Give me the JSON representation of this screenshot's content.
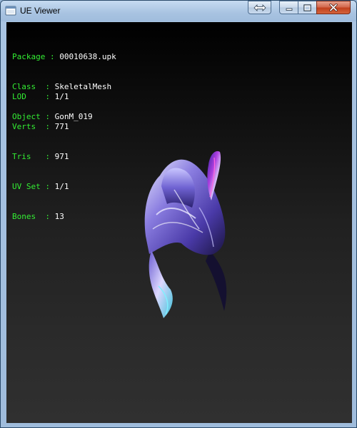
{
  "window": {
    "title": "UE Viewer"
  },
  "info_block_1": [
    {
      "label": "Package",
      "sep": " : ",
      "pad": "",
      "value": "00010638.upk"
    },
    {
      "label": "Class",
      "sep": "  : ",
      "pad": "",
      "value": "SkeletalMesh"
    },
    {
      "label": "Object",
      "sep": " : ",
      "pad": "",
      "value": "GonM_019"
    }
  ],
  "info_block_2": [
    {
      "label": "LOD",
      "sep": "    : ",
      "value": "1/1"
    },
    {
      "label": "Verts",
      "sep": "  : ",
      "value": "771"
    },
    {
      "label": "Tris",
      "sep": "   : ",
      "value": "971"
    },
    {
      "label": "UV Set",
      "sep": " : ",
      "value": "1/1"
    },
    {
      "label": "Bones",
      "sep": "  : ",
      "value": "13"
    }
  ],
  "colors": {
    "label_green": "#33ee33",
    "value_white": "#ffffff",
    "viewport_top": "#000000",
    "viewport_bottom": "#303030",
    "close_red": "#c2411e"
  },
  "icons": {
    "app": "ue-viewer-app-icon",
    "restore_alt": "double-arrow-icon",
    "minimize": "minimize-icon",
    "maximize": "maximize-icon",
    "close": "close-icon"
  }
}
